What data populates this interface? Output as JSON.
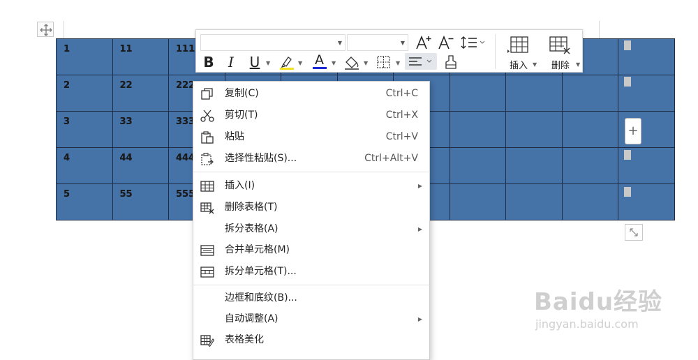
{
  "table": {
    "rows": [
      [
        "1",
        "11",
        "111",
        "",
        "",
        "",
        "",
        "",
        "",
        "",
        ""
      ],
      [
        "2",
        "22",
        "222",
        "",
        "",
        "",
        "",
        "",
        "",
        "",
        ""
      ],
      [
        "3",
        "33",
        "333",
        "",
        "",
        "",
        "",
        "",
        "",
        "",
        ""
      ],
      [
        "4",
        "44",
        "444",
        "",
        "",
        "",
        "",
        "",
        "",
        "",
        ""
      ],
      [
        "5",
        "55",
        "555",
        "",
        "",
        "",
        "",
        "",
        "",
        "",
        ""
      ]
    ],
    "fill_color": "#4572a7"
  },
  "toolbar": {
    "font_name_value": "",
    "font_size_value": "",
    "grow_font_icon": "A+",
    "shrink_font_icon": "A-",
    "bold": "B",
    "italic": "I",
    "underline": "U",
    "font_color_letter": "A",
    "insert_label": "插入",
    "delete_label": "删除"
  },
  "context_menu": {
    "items": [
      {
        "label": "复制(C)",
        "shortcut": "Ctrl+C"
      },
      {
        "label": "剪切(T)",
        "shortcut": "Ctrl+X"
      },
      {
        "label": "粘贴",
        "shortcut": "Ctrl+V"
      },
      {
        "label": "选择性粘贴(S)...",
        "shortcut": "Ctrl+Alt+V"
      },
      {
        "label": "插入(I)"
      },
      {
        "label": "删除表格(T)"
      },
      {
        "label": "拆分表格(A)"
      },
      {
        "label": "合并单元格(M)"
      },
      {
        "label": "拆分单元格(T)..."
      },
      {
        "label": "边框和底纹(B)..."
      },
      {
        "label": "自动调整(A)"
      },
      {
        "label": "表格美化"
      }
    ]
  },
  "add_column_symbol": "+",
  "watermark": {
    "main": "Baidu经验",
    "sub": "jingyan.baidu.com"
  }
}
